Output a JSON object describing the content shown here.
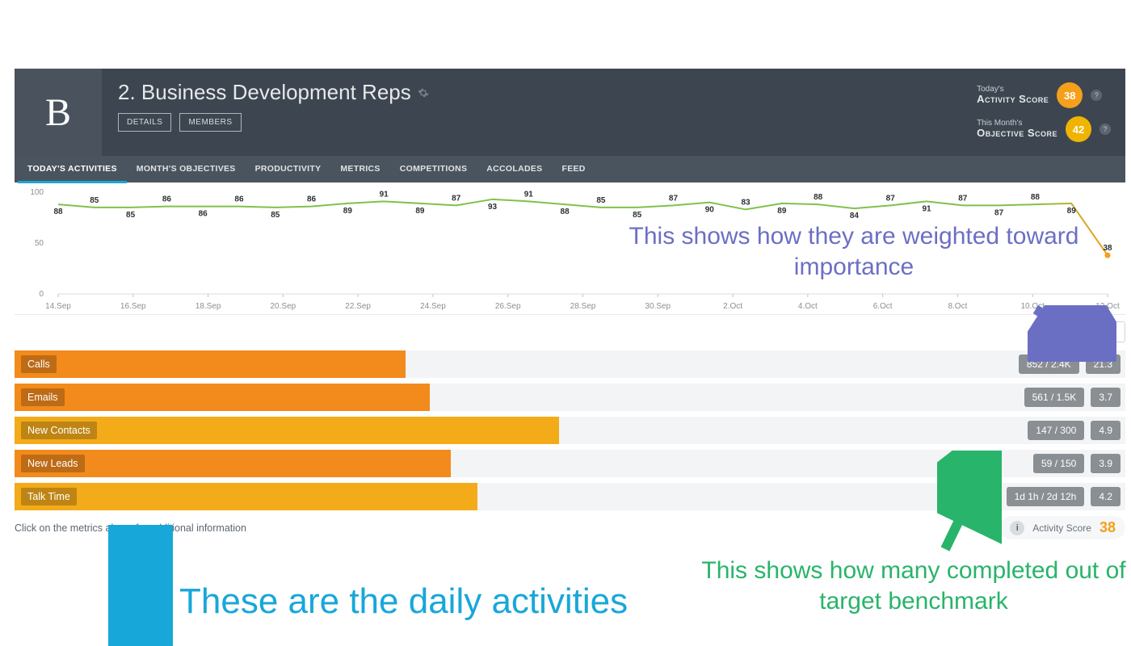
{
  "header": {
    "avatar_letter": "B",
    "title": "2. Business Development Reps",
    "buttons": {
      "details": "DETAILS",
      "members": "MEMBERS"
    }
  },
  "scores": {
    "activity": {
      "small": "Today's",
      "label": "Activity Score",
      "value": "38"
    },
    "objective": {
      "small": "This Month's",
      "label": "Objective Score",
      "value": "42"
    }
  },
  "tabs": [
    "TODAY'S ACTIVITIES",
    "MONTH'S OBJECTIVES",
    "PRODUCTIVITY",
    "METRICS",
    "COMPETITIONS",
    "ACCOLADES",
    "FEED"
  ],
  "active_tab": 0,
  "chart_data": {
    "type": "line",
    "ylim": [
      0,
      100
    ],
    "y_ticks": [
      0,
      50,
      100
    ],
    "x_ticks": [
      "14.Sep",
      "16.Sep",
      "18.Sep",
      "20.Sep",
      "22.Sep",
      "24.Sep",
      "26.Sep",
      "28.Sep",
      "30.Sep",
      "2.Oct",
      "4.Oct",
      "6.Oct",
      "8.Oct",
      "10.Oct",
      "12.Oct"
    ],
    "values": [
      88,
      85,
      85,
      86,
      86,
      86,
      85,
      86,
      89,
      91,
      89,
      87,
      93,
      91,
      88,
      85,
      85,
      87,
      90,
      83,
      89,
      88,
      84,
      87,
      91,
      87,
      87,
      88,
      89,
      38
    ],
    "value_labels": [
      "88",
      "85",
      "85",
      "86",
      "86",
      "86",
      "85",
      "86",
      "89",
      "91",
      "89",
      "87",
      "93",
      "91",
      "88",
      "85",
      "85",
      "87",
      "90",
      "83",
      "89",
      "88",
      "84",
      "87",
      "91",
      "87",
      "87",
      "88",
      "89",
      "38"
    ],
    "line_color_start": "#7fc24a",
    "line_color_end": "#f5a01a"
  },
  "activities": [
    {
      "label": "Calls",
      "fill_pct": 35.2,
      "color": "#f28a1c",
      "progress": "852 / 2.4K",
      "weight": "21.3"
    },
    {
      "label": "Emails",
      "fill_pct": 37.4,
      "color": "#f28a1c",
      "progress": "561 / 1.5K",
      "weight": "3.7"
    },
    {
      "label": "New Contacts",
      "fill_pct": 49.0,
      "color": "#f4ab1a",
      "progress": "147 / 300",
      "weight": "4.9"
    },
    {
      "label": "New Leads",
      "fill_pct": 39.3,
      "color": "#f28a1c",
      "progress": "59 / 150",
      "weight": "3.9"
    },
    {
      "label": "Talk Time",
      "fill_pct": 41.7,
      "color": "#f4ab1a",
      "progress": "1d 1h / 2d 12h",
      "weight": "4.2"
    }
  ],
  "footer": {
    "hint": "Click on the metrics above for additional information",
    "as_label": "Activity Score",
    "as_value": "38"
  },
  "annotations": {
    "purple": "This shows how they are weighted toward importance",
    "green": "This shows how many completed out of target benchmark",
    "blue": "These are the daily activities"
  }
}
